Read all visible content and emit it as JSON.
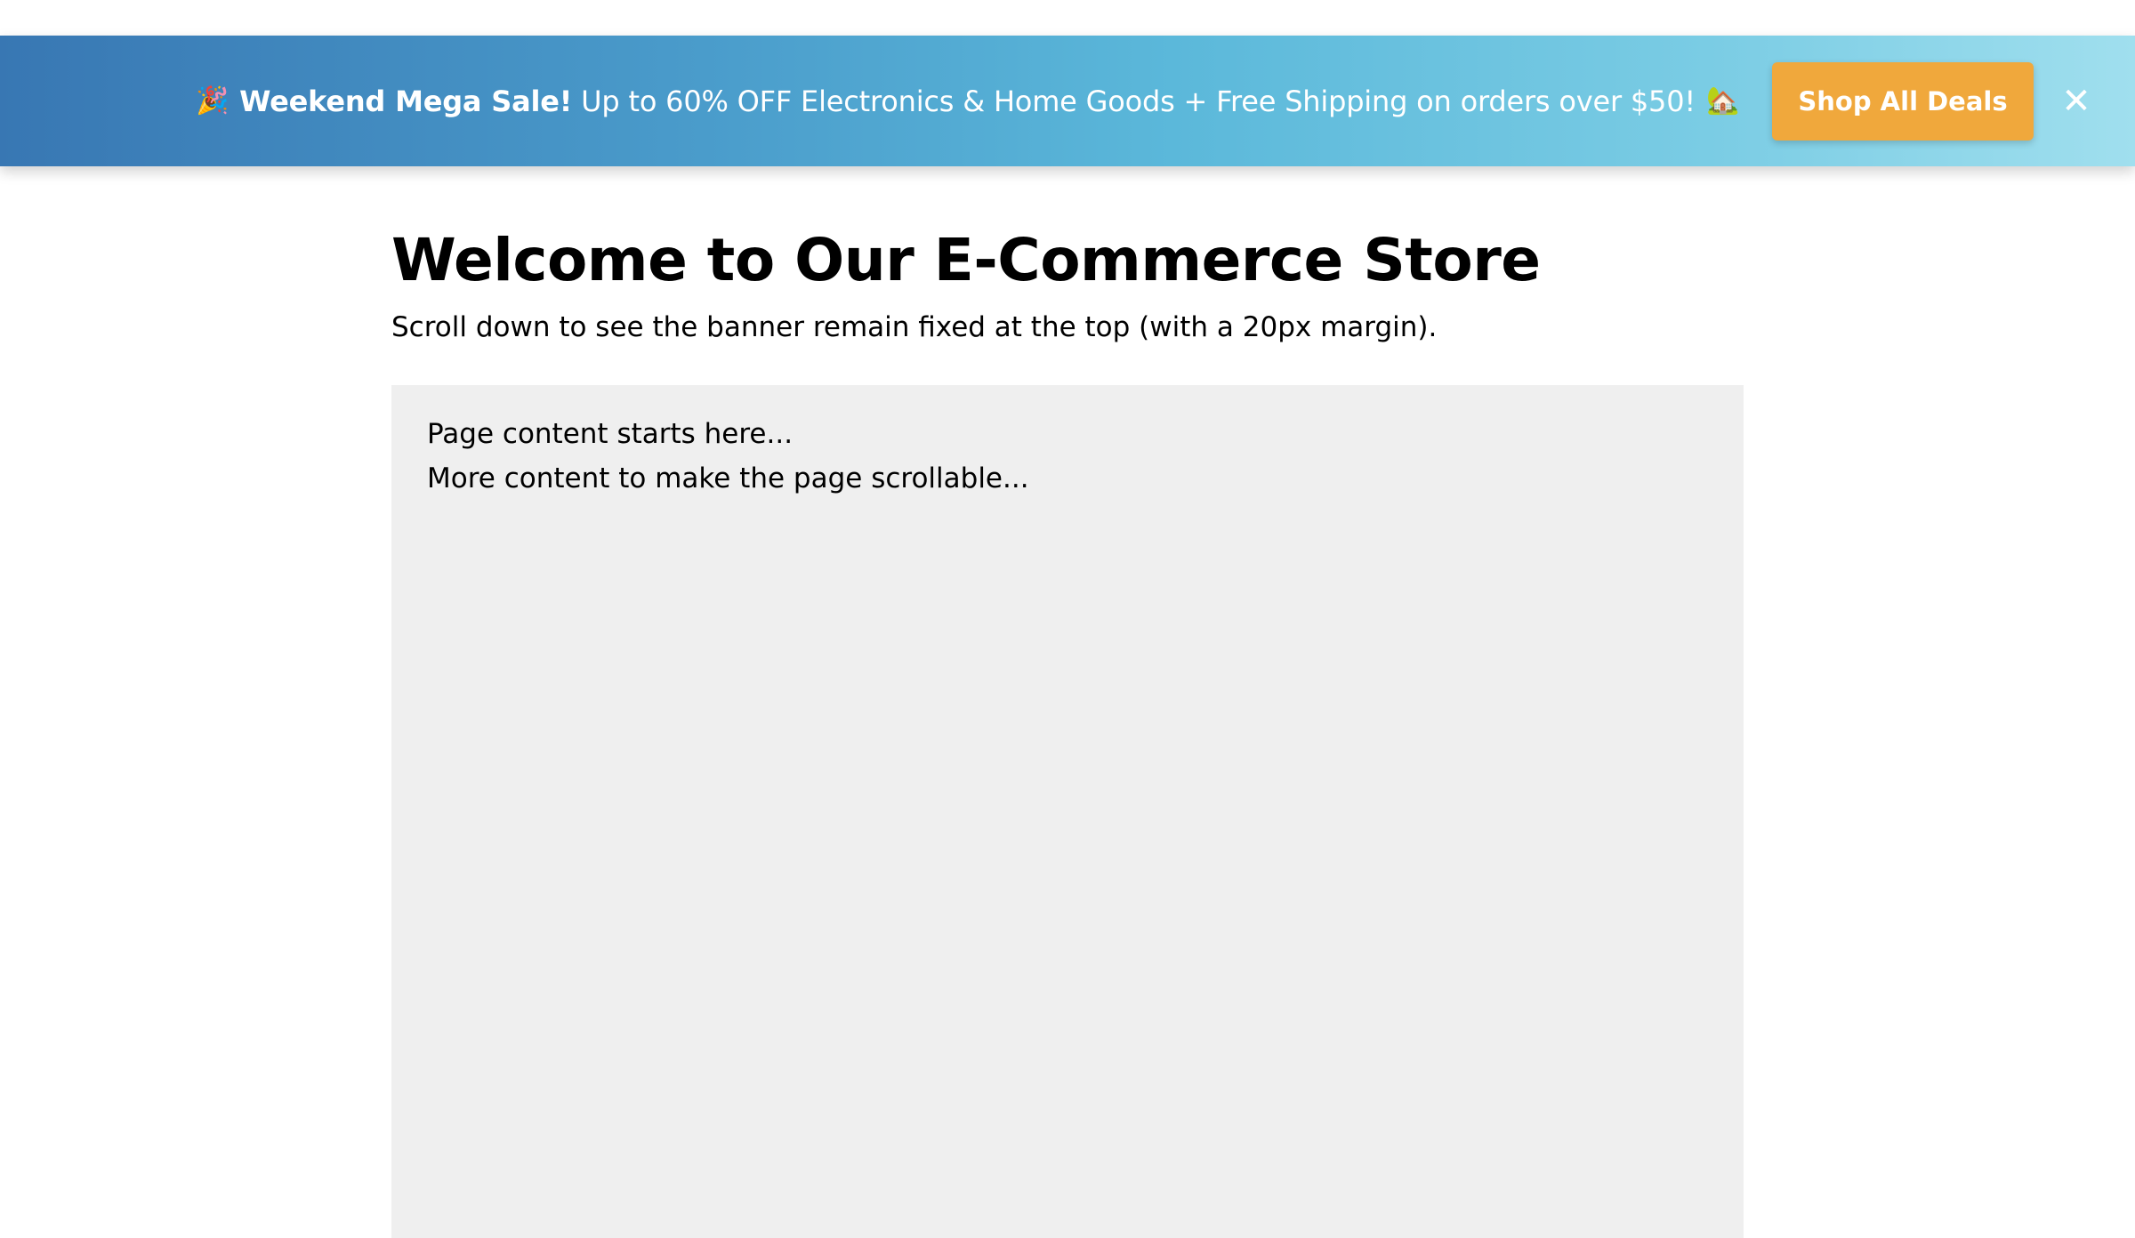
{
  "banner": {
    "emoji_start": "🎉",
    "headline": "Weekend Mega Sale!",
    "message": "Up to 60% OFF Electronics & Home Goods + Free Shipping on orders over $50!",
    "emoji_end": "🏡",
    "cta_label": "Shop All Deals",
    "close_label": "✕"
  },
  "main": {
    "title": "Welcome to Our E-Commerce Store",
    "subtitle": "Scroll down to see the banner remain fixed at the top (with a 20px margin).",
    "content_lines": [
      "Page content starts here...",
      "More content to make the page scrollable..."
    ]
  },
  "colors": {
    "banner_gradient_start": "#3877b3",
    "banner_gradient_end": "#a0dfee",
    "cta_background": "#f0a83c",
    "content_background": "#efefef"
  }
}
